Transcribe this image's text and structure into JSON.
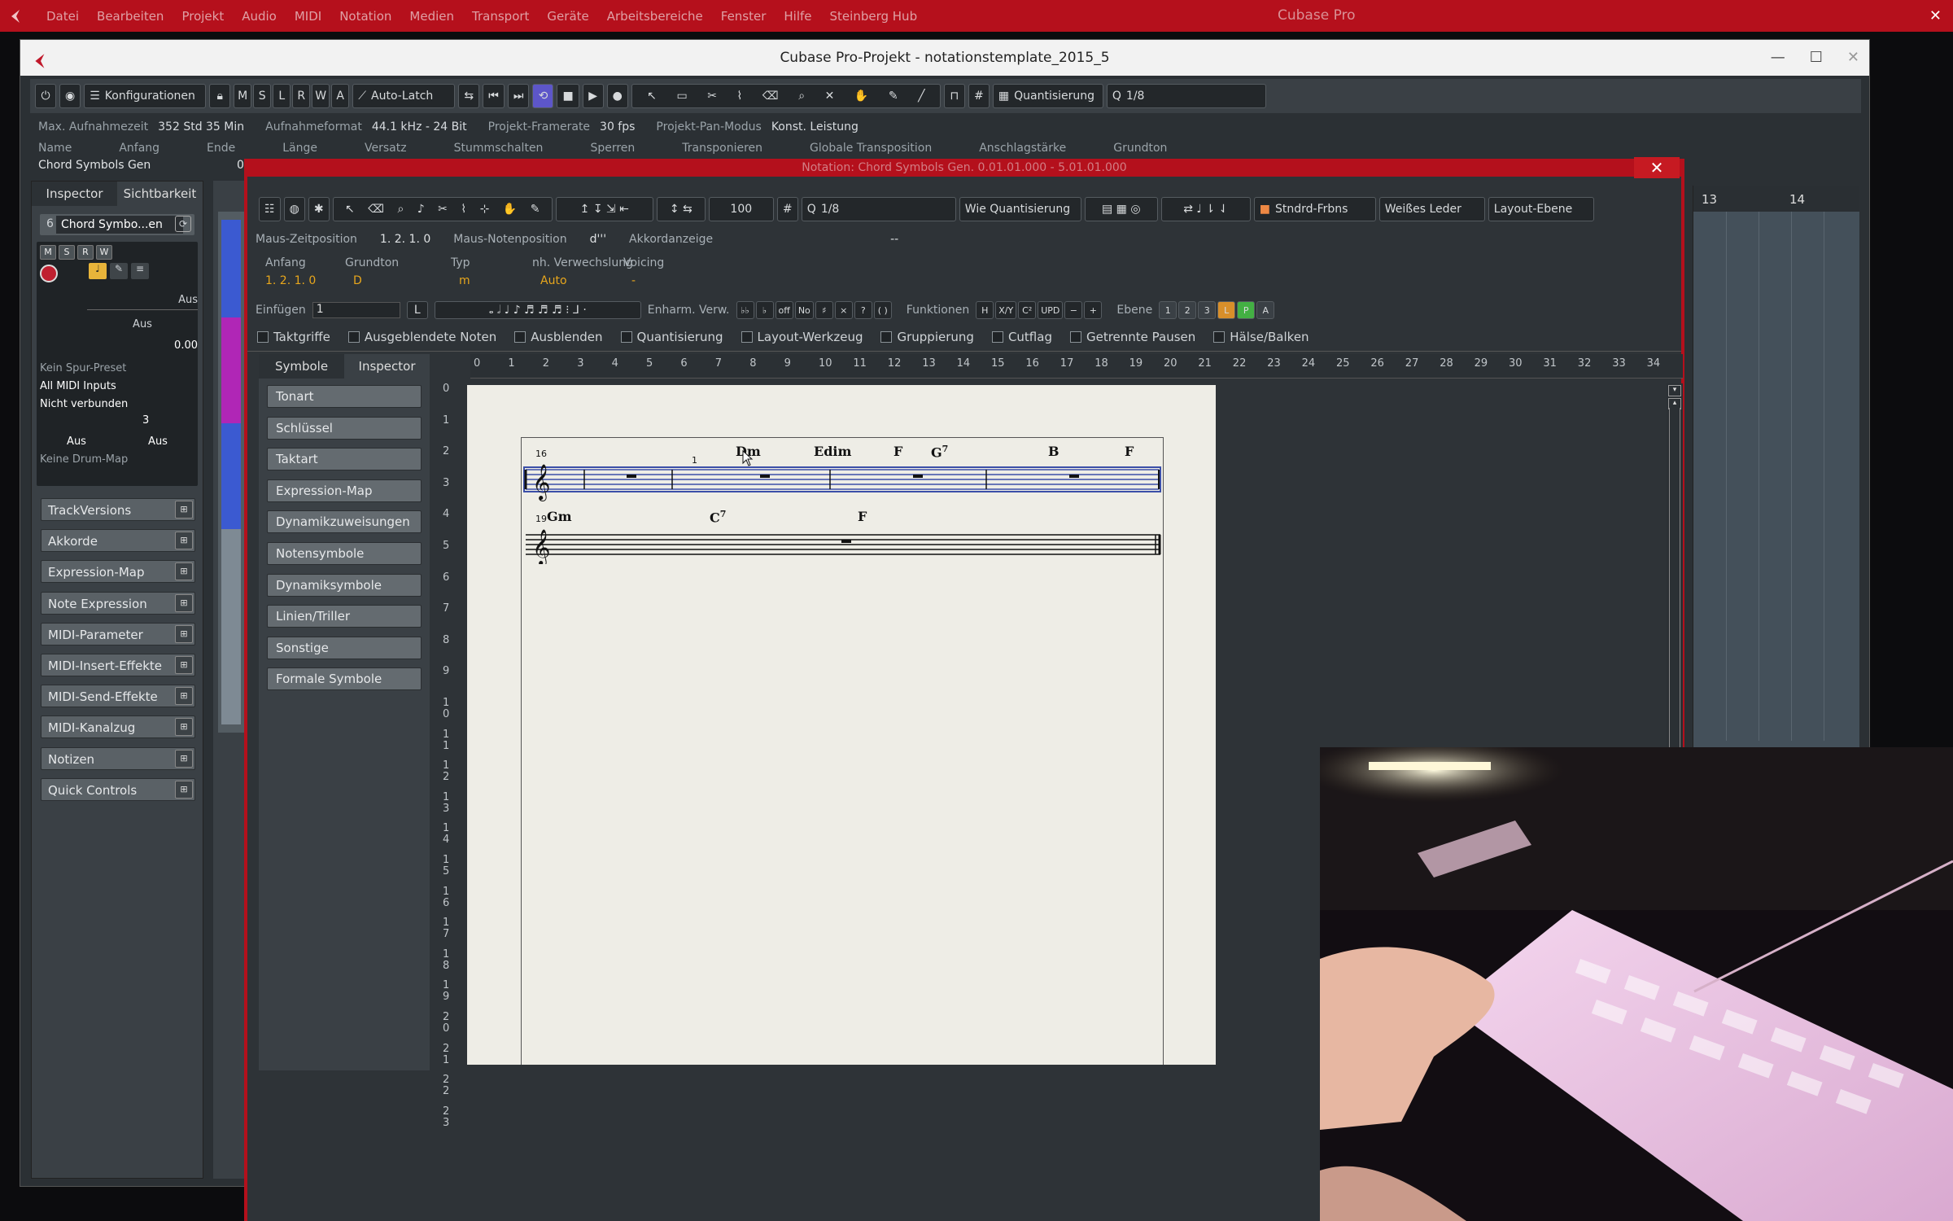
{
  "system": {
    "menu": [
      "Datei",
      "Bearbeiten",
      "Projekt",
      "Audio",
      "MIDI",
      "Notation",
      "Medien",
      "Transport",
      "Geräte",
      "Arbeitsbereiche",
      "Fenster",
      "Hilfe",
      "Steinberg Hub"
    ],
    "app_title": "Cubase Pro"
  },
  "project": {
    "title": "Cubase Pro-Projekt - notationstemplate_2015_5",
    "toolbar": {
      "konfig_label": "Konfigurationen",
      "letters": [
        "M",
        "S",
        "L",
        "R",
        "W",
        "A"
      ],
      "automation": "Auto-Latch",
      "quant_mode": "Quantisierung",
      "quant_value": "1/8"
    },
    "info": [
      {
        "label": "Max. Aufnahmezeit",
        "value": "352 Std 35 Min"
      },
      {
        "label": "Aufnahmeformat",
        "value": "44.1 kHz - 24 Bit"
      },
      {
        "label": "Projekt-Framerate",
        "value": "30 fps"
      },
      {
        "label": "Projekt-Pan-Modus",
        "value": "Konst. Leistung"
      }
    ],
    "columns": [
      "Name",
      "Anfang",
      "Ende",
      "Länge",
      "Versatz",
      "Stummschalten",
      "Sperren",
      "Transponieren",
      "Globale Transposition",
      "Anschlagstärke",
      "Grundton"
    ],
    "track_name": "Chord Symbols Gen",
    "track_value": "0."
  },
  "inspector": {
    "tabs": [
      "Inspector",
      "Sichtbarkeit"
    ],
    "track": "Chord Symbo...en",
    "track_num": "6",
    "msrw": [
      "M",
      "S",
      "R",
      "W"
    ],
    "out_label": "Aus",
    "out_label2": "Aus",
    "volume": "0.00",
    "preset": "Kein Spur-Preset",
    "midi_in": "All MIDI Inputs",
    "midi_out": "Nicht verbunden",
    "channel": "3",
    "aus_a": "Aus",
    "aus_b": "Aus",
    "drum": "Keine Drum-Map",
    "sections": [
      "TrackVersions",
      "Akkorde",
      "Expression-Map",
      "Note Expression",
      "MIDI-Parameter",
      "MIDI-Insert-Effekte",
      "MIDI-Send-Effekte",
      "MIDI-Kanalzug",
      "Notizen",
      "Quick Controls"
    ]
  },
  "notation": {
    "title": "Notation: Chord Symbols Gen. 0.01.01.000 - 5.01.01.000",
    "zoom": "100",
    "quant": "1/8",
    "quant_mode": "Wie Quantisierung",
    "color_mode": "Stndrd-Frbns",
    "bg": "Weißes Leder",
    "layer": "Layout-Ebene",
    "status": {
      "mouse_time_label": "Maus-Zeitposition",
      "mouse_time": "1. 2. 1.  0",
      "mouse_note_label": "Maus-Notenposition",
      "mouse_note": "d'''",
      "chord_label": "Akkordanzeige",
      "chord_value": "--"
    },
    "info_labels": [
      "Anfang",
      "Grundton",
      "Typ",
      "nh. Verwechslung",
      "Voicing"
    ],
    "info_values": [
      "1. 2. 1.  0",
      "D",
      "m",
      "Auto",
      "-"
    ],
    "insert_label": "Einfügen",
    "insert_value": "1",
    "l_btn": "L",
    "enh_label": "Enharm. Verw.",
    "enh_symbols": [
      "♭♭",
      "♭",
      "off",
      "No",
      "♯",
      "×",
      "?",
      "( )"
    ],
    "func_label": "Funktionen",
    "func_symbols": [
      "H",
      "X/Y",
      "C²",
      "UPD",
      "−",
      "+"
    ],
    "layer_label": "Ebene",
    "layers": [
      "1",
      "2",
      "3",
      "L",
      "P",
      "A"
    ],
    "checkboxes": [
      "Taktgriffe",
      "Ausgeblendete Noten",
      "Ausblenden",
      "Quantisierung",
      "Layout-Werkzeug",
      "Gruppierung",
      "Cutflag",
      "Getrennte Pausen",
      "Hälse/Balken"
    ],
    "sym_tabs": [
      "Symbole",
      "Inspector"
    ],
    "sym_buttons": [
      "Tonart",
      "Schlüssel",
      "Taktart",
      "Expression-Map",
      "Dynamikzuweisungen",
      "Notensymbole",
      "Dynamiksymbole",
      "Linien/Triller",
      "Sonstige",
      "Formale Symbole"
    ],
    "ruler": [
      "0",
      "1",
      "2",
      "3",
      "4",
      "5",
      "6",
      "7",
      "8",
      "9",
      "10",
      "11",
      "12",
      "13",
      "14",
      "15",
      "16",
      "17",
      "18",
      "19",
      "20",
      "21",
      "22",
      "23",
      "24",
      "25",
      "26",
      "27",
      "28",
      "29",
      "30",
      "31",
      "32",
      "33",
      "34"
    ],
    "vruler": [
      "0",
      "1",
      "2",
      "3",
      "4",
      "5",
      "6",
      "7",
      "8",
      "9",
      "1\n0",
      "1\n1",
      "1\n2",
      "1\n3",
      "1\n4",
      "1\n5",
      "1\n6",
      "1\n7",
      "1\n8",
      "1\n9",
      "2\n0",
      "2\n1",
      "2\n2",
      "2\n3"
    ],
    "score": {
      "sys1_bar": "16",
      "sys1_beat": "1",
      "sys1_chords": [
        "Dm",
        "Edim",
        "F",
        "G",
        "B",
        "F"
      ],
      "sys1_g_sup": "7",
      "sys2_bar": "19",
      "sys2_chords": [
        "Gm",
        "C",
        "F"
      ],
      "sys2_c_sup": "7"
    }
  },
  "arrange": {
    "bars": [
      "13",
      "14"
    ]
  }
}
